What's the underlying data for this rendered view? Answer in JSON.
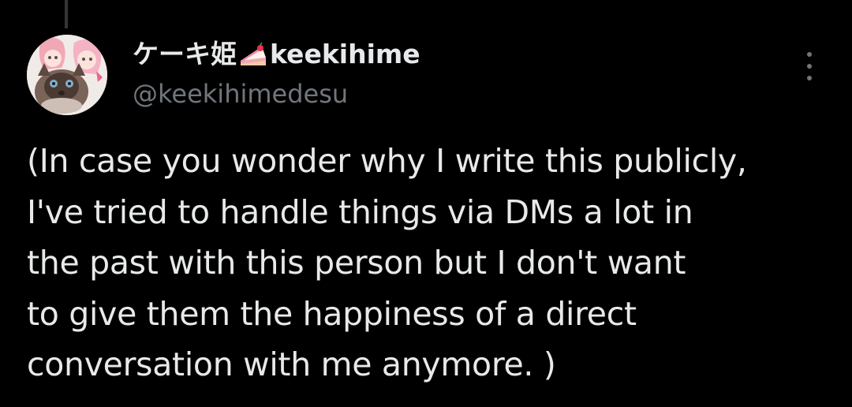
{
  "tweet": {
    "author": {
      "display_name_jp": "ケーキ姫",
      "display_name_emoji": "cake-icon",
      "display_name_en": "keekihime",
      "handle": "@keekihimedesu",
      "avatar": "avatar-anime-girls-with-cat"
    },
    "more_icon": "more-vertical-icon",
    "text_lines": [
      "(In case you wonder why I write this publicly,",
      "I've tried to handle things via DMs a lot in",
      "the past with this person but I don't want",
      "to give them the happiness of a direct",
      "conversation with me anymore. )"
    ]
  },
  "colors": {
    "background": "#000000",
    "primary_text": "#e7e9ea",
    "secondary_text": "#71767b",
    "thread_line": "#333639"
  }
}
